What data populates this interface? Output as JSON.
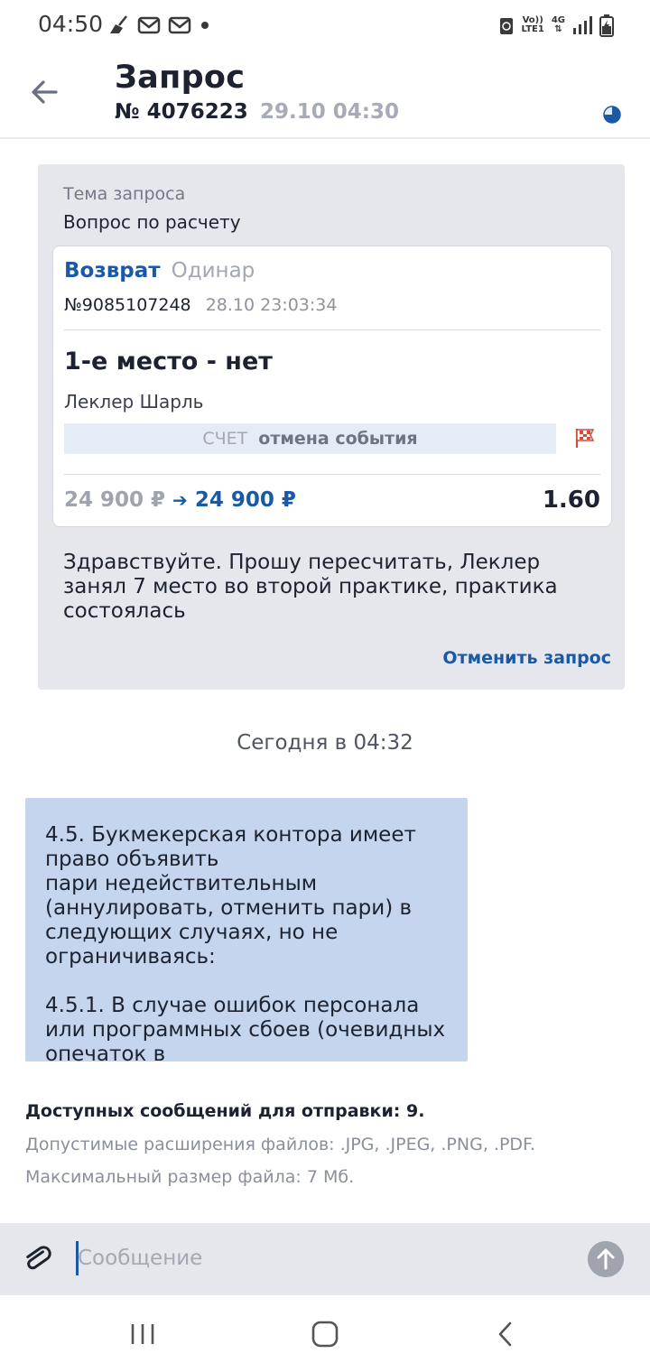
{
  "status_bar": {
    "time": "04:50",
    "network_top": "Vo))",
    "network_bottom": "LTE1",
    "network_type": "4G"
  },
  "header": {
    "title": "Запрос",
    "request_number": "№ 4076223",
    "request_date": "29.10 04:30",
    "status_color": "#1a5aa5"
  },
  "request": {
    "topic_label": "Тема запроса",
    "topic_value": "Вопрос по расчету",
    "bet": {
      "type_main": "Возврат",
      "type_sub": "Одинар",
      "number": "№9085107248",
      "datetime": "28.10 23:03:34",
      "outcome": "1-е место - нет",
      "participant": "Леклер Шарль",
      "score_label": "СЧЕТ",
      "score_value": "отмена события",
      "amount_old": "24 900 ₽",
      "amount_new": "24 900 ₽",
      "odds": "1.60"
    },
    "message": "Здравствуйте. Прошу пересчитать, Леклер занял 7 место во второй практике, практика состоялась",
    "cancel_label": "Отменить запрос"
  },
  "timeline": {
    "separator": "Сегодня в 04:32"
  },
  "reply": {
    "text": "4.5. Букмекерская контора имеет право объявить\nпари недействительным (аннулировать, отменить пари) в следующих случаях, но не ограничиваясь:\n\n4.5.1. В случае ошибок персонала или программных сбоев (очевидных опечаток в"
  },
  "info": {
    "messages_available": "Доступных сообщений для отправки: 9.",
    "allowed_extensions": "Допустимые расширения файлов: .JPG, .JPEG, .PNG, .PDF.",
    "max_size": "Максимальный размер файла: 7 Мб."
  },
  "composer": {
    "placeholder": "Сообщение",
    "value": ""
  },
  "colors": {
    "accent": "#1a5aa5",
    "card_bg": "#e6e7ec",
    "reply_bg": "#c5d5ed"
  }
}
